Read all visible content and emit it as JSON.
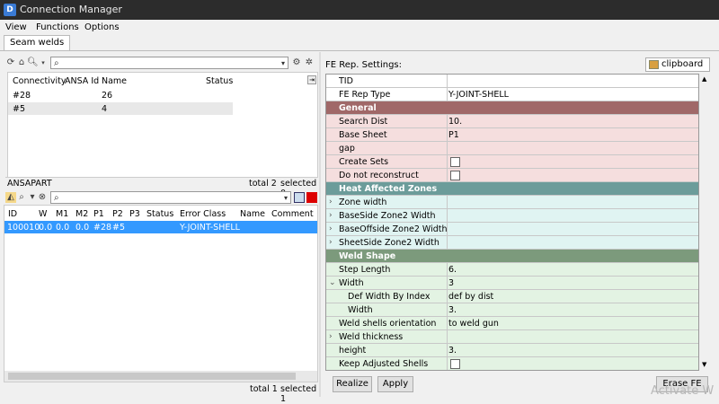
{
  "window": {
    "title": "Connection Manager"
  },
  "menu": [
    "View",
    "Functions",
    "Options"
  ],
  "tab": "Seam welds",
  "connectivity": {
    "headers": [
      "Connectivity",
      "ANSA Id",
      "Name",
      "Status"
    ],
    "rows": [
      {
        "connectivity": "#28",
        "ansa_id": "",
        "name": "26",
        "status": ""
      },
      {
        "connectivity": "#5",
        "ansa_id": "",
        "name": "4",
        "status": ""
      }
    ],
    "footer_label": "ANSAPART",
    "total": "total 2",
    "selected": "selected 0"
  },
  "connections": {
    "headers": [
      "ID",
      "W",
      "M1",
      "M2",
      "P1",
      "P2",
      "P3",
      "Status",
      "Error Class",
      "Name",
      "Comment"
    ],
    "rows": [
      {
        "id": "100010",
        "w": "0.0",
        "m1": "0.0",
        "m2": "0.0",
        "p1": "#28",
        "p2": "#5",
        "p3": "",
        "status": "",
        "error_class": "Y-JOINT-SHELL",
        "name": "",
        "comment": ""
      }
    ],
    "total": "total 1",
    "selected": "selected 1"
  },
  "fe": {
    "label": "FE Rep. Settings:",
    "clipboard": "clipboard",
    "rows": [
      {
        "type": "plain",
        "name": "TID",
        "value": ""
      },
      {
        "type": "plain",
        "name": "FE Rep Type",
        "value": "Y-JOINT-SHELL"
      },
      {
        "type": "section",
        "name": "General",
        "color": "#a06868"
      },
      {
        "type": "pink",
        "name": "Search Dist",
        "value": "10."
      },
      {
        "type": "pink",
        "name": "Base Sheet",
        "value": "P1"
      },
      {
        "type": "pink",
        "name": "gap",
        "value": ""
      },
      {
        "type": "pink",
        "name": "Create Sets",
        "check": true
      },
      {
        "type": "pink",
        "name": "Do not reconstruct",
        "check": true
      },
      {
        "type": "section",
        "name": "Heat Affected Zones",
        "color": "#6c9c9a"
      },
      {
        "type": "cyan",
        "name": "Zone width",
        "arrow": ">",
        "value": ""
      },
      {
        "type": "cyan",
        "name": "BaseSide Zone2 Width",
        "arrow": ">",
        "value": ""
      },
      {
        "type": "cyan",
        "name": "BaseOffside Zone2 Width",
        "arrow": ">",
        "value": ""
      },
      {
        "type": "cyan",
        "name": "SheetSide Zone2 Width",
        "arrow": ">",
        "value": ""
      },
      {
        "type": "section",
        "name": "Weld Shape",
        "color": "#7c9a7c"
      },
      {
        "type": "green",
        "name": "Step Length",
        "value": "6."
      },
      {
        "type": "green",
        "name": "Width",
        "arrow": "v",
        "value": "3"
      },
      {
        "type": "green",
        "name": "Def Width By Index",
        "indent": true,
        "value": "def by dist"
      },
      {
        "type": "green",
        "name": "Width",
        "indent": true,
        "value": "3."
      },
      {
        "type": "green",
        "name": "Weld shells orientation",
        "value": "to weld gun"
      },
      {
        "type": "green",
        "name": "Weld thickness",
        "arrow": ">",
        "value": ""
      },
      {
        "type": "green",
        "name": "height",
        "value": "3."
      },
      {
        "type": "green",
        "name": "Keep Adjusted Shells",
        "check": true
      }
    ],
    "realize": "Realize",
    "apply": "Apply",
    "erase": "Erase FE"
  },
  "watermark": "Activate W",
  "colors": {
    "selection": "#3399ff",
    "pink": "#f5dede",
    "cyan": "#e0f4f2",
    "green": "#e3f3e3"
  }
}
